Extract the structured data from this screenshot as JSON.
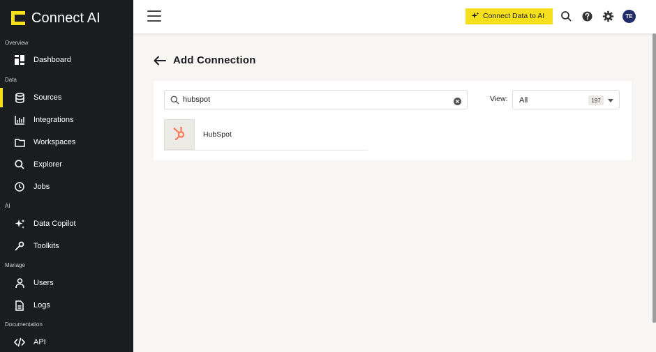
{
  "app": {
    "logo_text": "Connect AI"
  },
  "sidebar": {
    "sections": {
      "overview": "Overview",
      "data": "Data",
      "ai": "AI",
      "manage": "Manage",
      "documentation": "Documentation"
    },
    "items": {
      "dashboard": "Dashboard",
      "sources": "Sources",
      "integrations": "Integrations",
      "workspaces": "Workspaces",
      "explorer": "Explorer",
      "jobs": "Jobs",
      "data_copilot": "Data Copilot",
      "toolkits": "Toolkits",
      "users": "Users",
      "logs": "Logs",
      "api": "API"
    },
    "active_item": "sources"
  },
  "header": {
    "cta_label": "Connect Data to AI",
    "avatar_initials": "TE"
  },
  "main": {
    "title": "Add Connection",
    "search": {
      "value": "hubspot"
    },
    "view": {
      "label": "View:",
      "value": "All",
      "count": "197"
    },
    "results": [
      {
        "name": "HubSpot"
      }
    ]
  },
  "colors": {
    "accent": "#f6e01b",
    "sidebar_bg": "#1b1c1f",
    "page_bg": "#f7f6f3",
    "avatar_bg": "#1f2c6b",
    "hubspot_orange": "#ff7a59"
  }
}
